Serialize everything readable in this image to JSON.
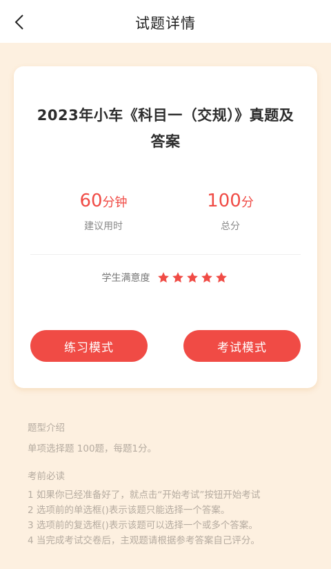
{
  "header": {
    "title": "试题详情"
  },
  "exam": {
    "title": "2023年小车《科目一（交规）》真题及答案",
    "duration_value": "60",
    "duration_unit": "分钟",
    "duration_label": "建议用时",
    "score_value": "100",
    "score_unit": "分",
    "score_label": "总分",
    "satisfaction_label": "学生满意度",
    "rating": 5,
    "rating_max": 5
  },
  "buttons": {
    "practice": "练习模式",
    "exam": "考试模式"
  },
  "intro": {
    "title": "题型介绍",
    "text": "单项选择题 100题，每题1分。"
  },
  "notes": {
    "title": "考前必读",
    "lines": [
      "1 如果你已经准备好了，就点击“开始考试”按钮开始考试",
      " 2 选项前的单选框()表示该题只能选择一个答案。",
      " 3 选项前的复选框()表示该题可以选择一个或多个答案。",
      " 4 当完成考试交卷后，主观题请根据参考答案自己评分。"
    ]
  },
  "colors": {
    "accent": "#f04b45",
    "background": "#fdf0e0",
    "muted_text": "#b5aba0"
  }
}
